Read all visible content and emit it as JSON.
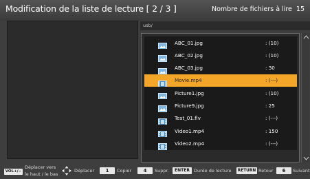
{
  "header": {
    "title": "Modification de la liste de lecture  [ 2 / 3 ]",
    "count_label": "Nombre de fichiers à lire",
    "count_value": "15"
  },
  "path": "usb/",
  "files": [
    {
      "name": "ABC_01.jpg",
      "value": ": (10)",
      "icon": "image-file-icon",
      "selected": false
    },
    {
      "name": "ABC_02.jpg",
      "value": ": (10)",
      "icon": "image-file-icon",
      "selected": false
    },
    {
      "name": "ABC_03.jpg",
      "value": ": 30",
      "icon": "image-file-icon",
      "selected": false
    },
    {
      "name": "Movie.mp4",
      "value": ": (---)",
      "icon": "video-file-icon",
      "selected": true
    },
    {
      "name": "Picture1.jpg",
      "value": ": (10)",
      "icon": "image-file-icon",
      "selected": false
    },
    {
      "name": "Picture9.jpg",
      "value": ": 25",
      "icon": "image-file-icon",
      "selected": false
    },
    {
      "name": "Test_01.flv",
      "value": ": (---)",
      "icon": "video-file-icon",
      "selected": false
    },
    {
      "name": "Video1.mp4",
      "value": ": 150",
      "icon": "video-file-icon",
      "selected": false
    },
    {
      "name": "Video2.mp4",
      "value": ": (---)",
      "icon": "video-file-icon",
      "selected": false
    }
  ],
  "footer": {
    "vol_key": "VOL+/−",
    "vol_label_line1": "Déplacer vers",
    "vol_label_line2": "le haut / le bas",
    "dpad_label": "Déplacer",
    "copy_key": "1",
    "copy_label": "Copier",
    "delete_key": "4",
    "delete_label": "Suppr.",
    "enter_key": "ENTER",
    "enter_label": "Durée de lecture",
    "return_key": "RETURN",
    "return_label": "Retour",
    "next_key": "6",
    "next_label": "Suivant"
  },
  "colors": {
    "background": "#3e3e3e",
    "selected_row": "#f3a628",
    "row": "#1a1a1a"
  }
}
